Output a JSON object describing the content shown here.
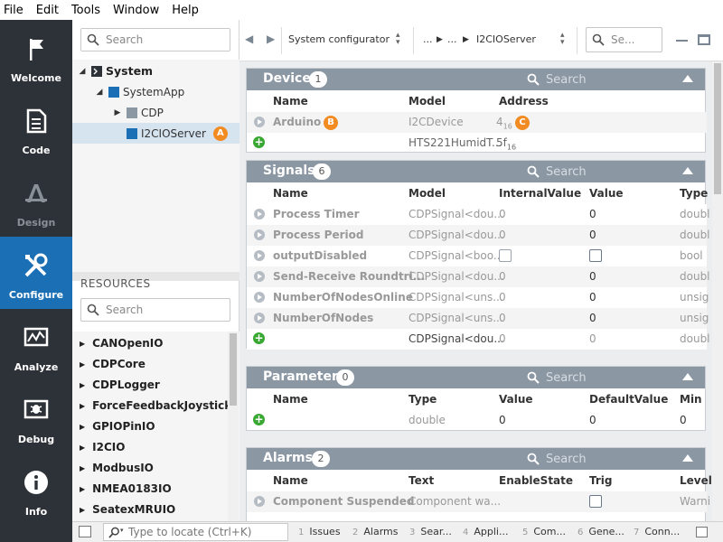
{
  "menu": [
    "File",
    "Edit",
    "Tools",
    "Window",
    "Help"
  ],
  "nav": [
    {
      "label": "Welcome",
      "icon": "flag-icon",
      "state": "normal"
    },
    {
      "label": "Code",
      "icon": "document-icon",
      "state": "normal"
    },
    {
      "label": "Design",
      "icon": "design-icon",
      "state": "disabled"
    },
    {
      "label": "Configure",
      "icon": "tools-icon",
      "state": "active"
    },
    {
      "label": "Analyze",
      "icon": "chart-icon",
      "state": "normal"
    },
    {
      "label": "Debug",
      "icon": "debug-icon",
      "state": "normal"
    },
    {
      "label": "Info",
      "icon": "info-icon",
      "state": "normal"
    }
  ],
  "side": {
    "search_placeholder": "Search",
    "tree": [
      {
        "label": "System",
        "badge": ""
      },
      {
        "label": "SystemApp",
        "badge": ""
      },
      {
        "label": "CDP",
        "badge": ""
      },
      {
        "label": "I2CIOServer",
        "badge": "A"
      }
    ],
    "resources_title": "RESOURCES",
    "resources_search_placeholder": "Search",
    "resources": [
      "CANOpenIO",
      "CDPCore",
      "CDPLogger",
      "ForceFeedbackJoystick",
      "GPIOPinIO",
      "I2CIO",
      "ModbusIO",
      "NMEA0183IO",
      "SeatexMRUIO"
    ]
  },
  "topbar": {
    "crumb1": "System configurator",
    "crumb2a": "...",
    "crumb2b": "...",
    "crumb3": "I2CIOServer",
    "search_placeholder": "Se..."
  },
  "device": {
    "title": "Device",
    "count": "1",
    "search": "Search",
    "cols": [
      "Name",
      "Model",
      "Address"
    ],
    "rows": [
      {
        "name": "Arduino",
        "badge": "B",
        "model": "I2CDevice",
        "addr": "4",
        "addr_sub": "16",
        "addr_badge": "C"
      },
      {
        "name": "",
        "model": "HTS221HumidT...",
        "addr": "5f",
        "addr_sub": "16"
      }
    ]
  },
  "signals": {
    "title": "Signals",
    "count": "6",
    "search": "Search",
    "cols": [
      "Name",
      "Model",
      "InternalValue",
      "Value",
      "Type"
    ],
    "rows": [
      {
        "name": "Process Timer",
        "model": "CDPSignal<dou...",
        "iv": "0",
        "val": "0",
        "type": "doubl"
      },
      {
        "name": "Process Period",
        "model": "CDPSignal<dou...",
        "iv": "0",
        "val": "0",
        "type": "doubl"
      },
      {
        "name": "outputDisabled",
        "model": "CDPSignal<boo...",
        "iv": "",
        "val": "",
        "type": "bool"
      },
      {
        "name": "Send-Receive Roundtri...",
        "model": "CDPSignal<dou...",
        "iv": "0",
        "val": "0",
        "type": "doubl"
      },
      {
        "name": "NumberOfNodesOnline",
        "model": "CDPSignal<uns...",
        "iv": "0",
        "val": "0",
        "type": "unsig"
      },
      {
        "name": "NumberOfNodes",
        "model": "CDPSignal<uns...",
        "iv": "0",
        "val": "0",
        "type": "unsig"
      },
      {
        "name": "",
        "model": "CDPSignal<dou...",
        "iv": "0",
        "val": "0",
        "type": "doubl"
      }
    ]
  },
  "parameters": {
    "title": "Parameters",
    "count": "0",
    "search": "Search",
    "cols": [
      "Name",
      "Type",
      "Value",
      "DefaultValue",
      "Min"
    ],
    "row": {
      "type": "double",
      "val": "0",
      "def": "0",
      "min": "0"
    }
  },
  "alarms": {
    "title": "Alarms",
    "count": "2",
    "search": "Search",
    "cols": [
      "Name",
      "Text",
      "EnableState",
      "Trig",
      "Level"
    ],
    "rows": [
      {
        "name": "Component Suspended",
        "text": "Component wa...",
        "level": "Warni"
      }
    ]
  },
  "status": {
    "locate_placeholder": "Type to locate (Ctrl+K)",
    "tabs": [
      {
        "n": "1",
        "label": "Issues"
      },
      {
        "n": "2",
        "label": "Alarms"
      },
      {
        "n": "3",
        "label": "Sear..."
      },
      {
        "n": "4",
        "label": "Appli..."
      },
      {
        "n": "5",
        "label": "Com..."
      },
      {
        "n": "6",
        "label": "Gene..."
      },
      {
        "n": "7",
        "label": "Conn..."
      }
    ]
  }
}
